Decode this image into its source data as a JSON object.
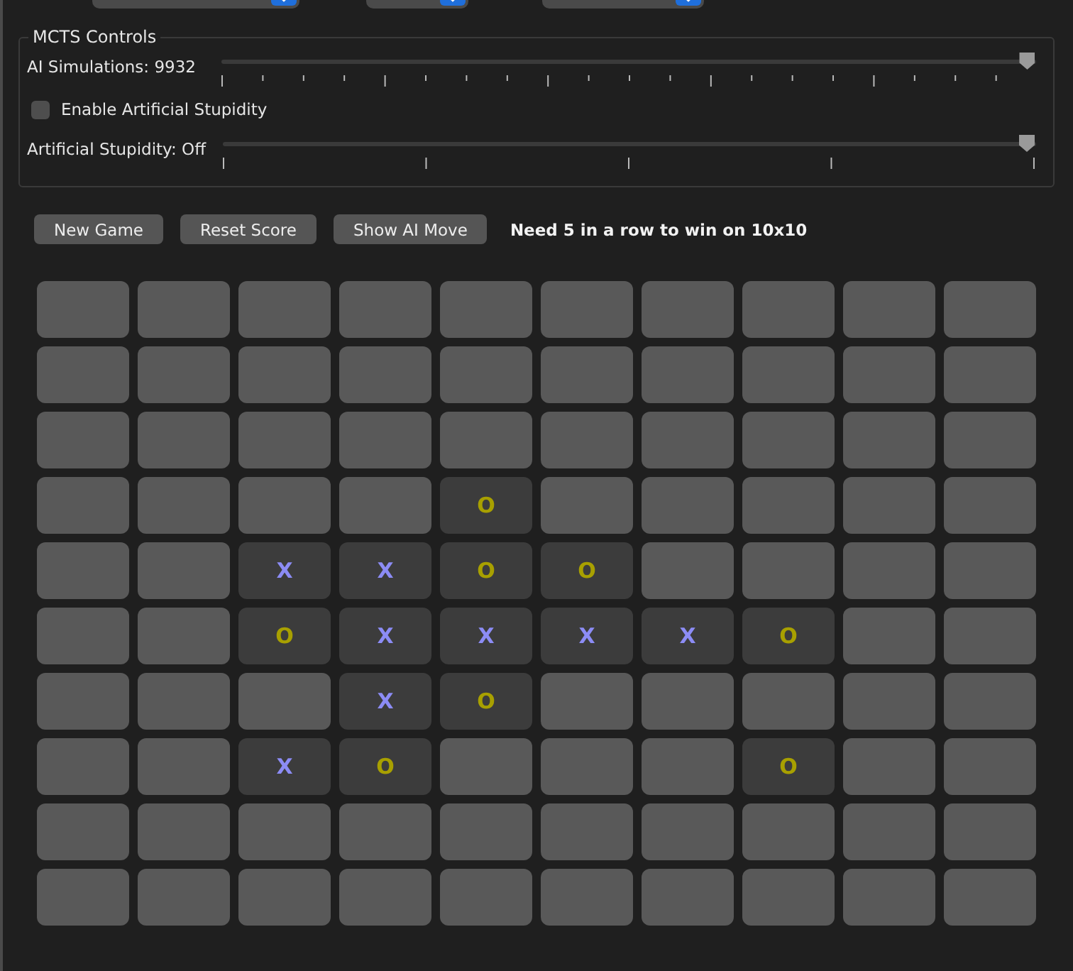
{
  "mcts_controls": {
    "title": "MCTS Controls",
    "simulations": {
      "label": "AI Simulations: 9932",
      "level": 0.99
    },
    "stupidity_toggle": {
      "label": "Enable Artificial Stupidity",
      "checked": false
    },
    "stupidity": {
      "label": "Artificial Stupidity: Off",
      "level": 1.0
    }
  },
  "buttons": [
    "New Game",
    "Reset Score",
    "Show AI Move"
  ],
  "message": "Need 5 in a row to win on 10x10",
  "board": [
    [
      {
        "occupied": false
      },
      {
        "occupied": false
      },
      {
        "occupied": false
      },
      {
        "occupied": false
      },
      {
        "occupied": false
      },
      {
        "occupied": false
      },
      {
        "occupied": false
      },
      {
        "occupied": false
      },
      {
        "occupied": false
      },
      {
        "occupied": false
      }
    ],
    [
      {
        "occupied": false
      },
      {
        "occupied": false
      },
      {
        "occupied": false
      },
      {
        "occupied": false
      },
      {
        "occupied": false
      },
      {
        "occupied": false
      },
      {
        "occupied": false
      },
      {
        "occupied": false
      },
      {
        "occupied": false
      },
      {
        "occupied": false
      }
    ],
    [
      {
        "occupied": false
      },
      {
        "occupied": false
      },
      {
        "occupied": false
      },
      {
        "occupied": false
      },
      {
        "occupied": false
      },
      {
        "occupied": false
      },
      {
        "occupied": false
      },
      {
        "occupied": false
      },
      {
        "occupied": false
      },
      {
        "occupied": false
      }
    ],
    [
      {
        "occupied": false
      },
      {
        "occupied": false
      },
      {
        "occupied": false
      },
      {
        "occupied": false
      },
      {
        "occupied": true,
        "mark": "O"
      },
      {
        "occupied": false
      },
      {
        "occupied": false
      },
      {
        "occupied": false
      },
      {
        "occupied": false
      },
      {
        "occupied": false
      }
    ],
    [
      {
        "occupied": false
      },
      {
        "occupied": false
      },
      {
        "occupied": true,
        "mark": "X"
      },
      {
        "occupied": true,
        "mark": "X"
      },
      {
        "occupied": true,
        "mark": "O"
      },
      {
        "occupied": true,
        "mark": "O"
      },
      {
        "occupied": false
      },
      {
        "occupied": false
      },
      {
        "occupied": false
      },
      {
        "occupied": false
      }
    ],
    [
      {
        "occupied": false
      },
      {
        "occupied": false
      },
      {
        "occupied": true,
        "mark": "O"
      },
      {
        "occupied": true,
        "mark": "X"
      },
      {
        "occupied": true,
        "mark": "X"
      },
      {
        "occupied": true,
        "mark": "X"
      },
      {
        "occupied": true,
        "mark": "X"
      },
      {
        "occupied": true,
        "mark": "O"
      },
      {
        "occupied": false
      },
      {
        "occupied": false
      }
    ],
    [
      {
        "occupied": false
      },
      {
        "occupied": false
      },
      {
        "occupied": false
      },
      {
        "occupied": true,
        "mark": "X"
      },
      {
        "occupied": true,
        "mark": "O"
      },
      {
        "occupied": false
      },
      {
        "occupied": false
      },
      {
        "occupied": false
      },
      {
        "occupied": false
      },
      {
        "occupied": false
      }
    ],
    [
      {
        "occupied": false
      },
      {
        "occupied": false
      },
      {
        "occupied": true,
        "mark": "X"
      },
      {
        "occupied": true,
        "mark": "O"
      },
      {
        "occupied": false
      },
      {
        "occupied": false
      },
      {
        "occupied": false
      },
      {
        "occupied": true,
        "mark": "O"
      },
      {
        "occupied": false
      },
      {
        "occupied": false
      }
    ],
    [
      {
        "occupied": false
      },
      {
        "occupied": false
      },
      {
        "occupied": false
      },
      {
        "occupied": false
      },
      {
        "occupied": false
      },
      {
        "occupied": false
      },
      {
        "occupied": false
      },
      {
        "occupied": false
      },
      {
        "occupied": false
      },
      {
        "occupied": false
      }
    ],
    [
      {
        "occupied": false
      },
      {
        "occupied": false
      },
      {
        "occupied": false
      },
      {
        "occupied": false
      },
      {
        "occupied": false
      },
      {
        "occupied": false
      },
      {
        "occupied": false
      },
      {
        "occupied": false
      },
      {
        "occupied": false
      },
      {
        "occupied": false
      }
    ]
  ]
}
